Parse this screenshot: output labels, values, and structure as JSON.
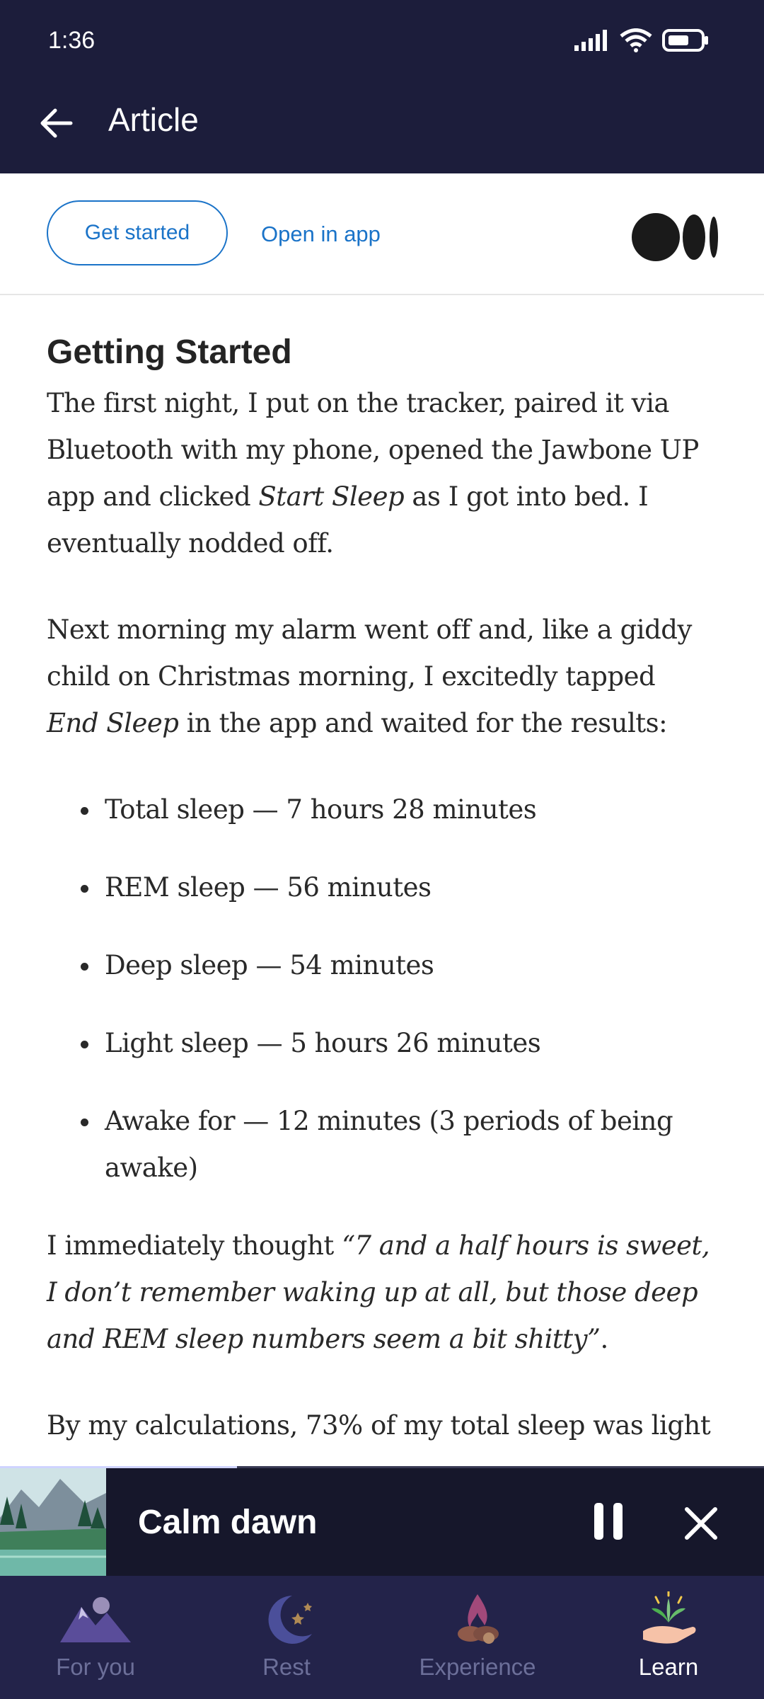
{
  "status_bar": {
    "time": "1:36"
  },
  "app_bar": {
    "title": "Article"
  },
  "web_header": {
    "get_started": "Get started",
    "open_in_app": "Open in app"
  },
  "article": {
    "heading": "Getting Started",
    "p1_a": "The first night, I put on the tracker, paired it via Bluetooth with my phone, opened the Jawbone UP app and clicked ",
    "p1_em": "Start Sleep",
    "p1_b": " as I got into bed. I eventually nodded off.",
    "p2_a": "Next morning my alarm went off and, like a giddy child on Christmas morning, I excitedly tapped ",
    "p2_em": "End Sleep",
    "p2_b": " in the app and waited for the results:",
    "list": [
      "Total sleep — 7 hours 28 minutes",
      "REM sleep — 56 minutes",
      "Deep sleep — 54 minutes",
      "Light sleep — 5 hours 26 minutes",
      "Awake for — 12 minutes (3 periods of being awake)"
    ],
    "p3_a": "I immediately thought ",
    "p3_em": "“7 and a half hours is sweet, I don’t remember waking up at all, but those deep and REM sleep numbers seem a bit shitty”",
    "p3_b": ".",
    "p4": "By my calculations, 73% of my total sleep was light"
  },
  "mini_player": {
    "title": "Calm dawn",
    "progress_fraction": 0.31
  },
  "bottom_nav": [
    {
      "label": "For you",
      "icon": "mountain-icon"
    },
    {
      "label": "Rest",
      "icon": "moon-stars-icon"
    },
    {
      "label": "Experience",
      "icon": "campfire-icon"
    },
    {
      "label": "Learn",
      "icon": "plant-hand-icon"
    }
  ],
  "colors": {
    "dark_bar": "#1c1d3b",
    "link_blue": "#1a73c8",
    "nav_bg": "#23234a",
    "player_bg": "#16172b"
  }
}
